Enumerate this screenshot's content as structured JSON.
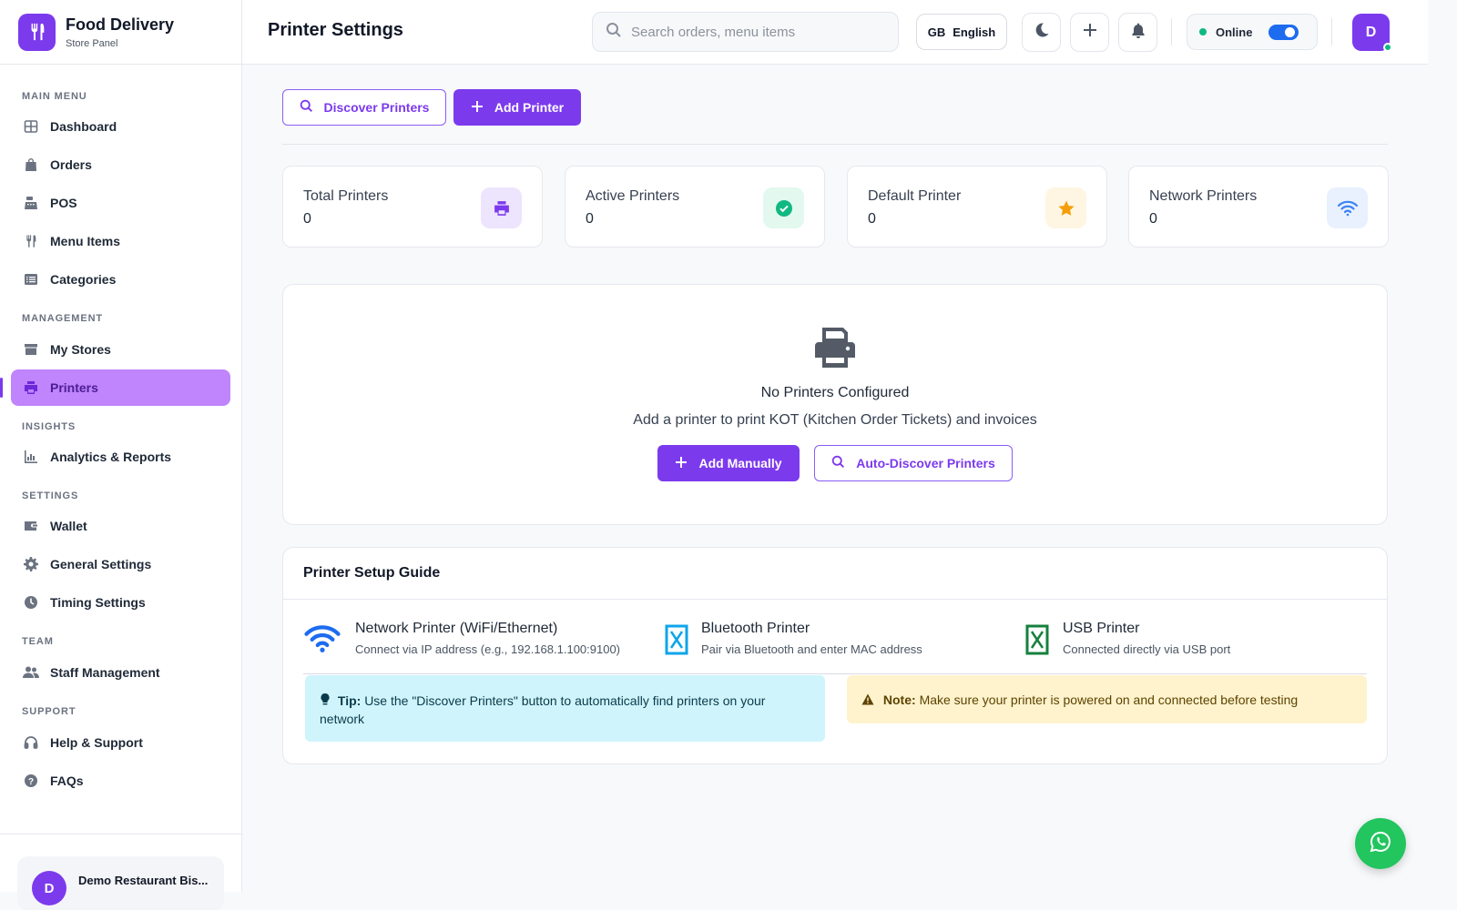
{
  "brand": {
    "title": "Food Delivery",
    "subtitle": "Store Panel",
    "icon": "utensils-icon"
  },
  "sidebar": {
    "sections": [
      {
        "title": "MAIN MENU",
        "items": [
          {
            "label": "Dashboard",
            "icon": "grid-icon"
          },
          {
            "label": "Orders",
            "icon": "shopping-bag-icon"
          },
          {
            "label": "POS",
            "icon": "cash-register-icon"
          },
          {
            "label": "Menu Items",
            "icon": "utensils-icon"
          },
          {
            "label": "Categories",
            "icon": "list-icon"
          }
        ]
      },
      {
        "title": "MANAGEMENT",
        "items": [
          {
            "label": "My Stores",
            "icon": "store-icon"
          },
          {
            "label": "Printers",
            "icon": "printer-icon",
            "active": true
          }
        ]
      },
      {
        "title": "INSIGHTS",
        "items": [
          {
            "label": "Analytics & Reports",
            "icon": "chart-icon"
          }
        ]
      },
      {
        "title": "SETTINGS",
        "items": [
          {
            "label": "Wallet",
            "icon": "wallet-icon"
          },
          {
            "label": "General Settings",
            "icon": "gear-icon"
          },
          {
            "label": "Timing Settings",
            "icon": "clock-icon"
          }
        ]
      },
      {
        "title": "TEAM",
        "items": [
          {
            "label": "Staff Management",
            "icon": "users-icon"
          }
        ]
      },
      {
        "title": "SUPPORT",
        "items": [
          {
            "label": "Help & Support",
            "icon": "headset-icon"
          },
          {
            "label": "FAQs",
            "icon": "question-icon"
          }
        ]
      }
    ],
    "store": {
      "avatar": "D",
      "name": "Demo Restaurant Bis..."
    }
  },
  "header": {
    "title": "Printer Settings",
    "search_placeholder": "Search orders, menu items",
    "lang_code": "GB",
    "lang_label": "English",
    "status_label": "Online",
    "online": true,
    "avatar": "D"
  },
  "actions": {
    "discover_label": "Discover Printers",
    "add_label": "Add Printer"
  },
  "stats": [
    {
      "label": "Total Printers",
      "value": "0",
      "icon": "printer-icon",
      "color": "#7c3aed",
      "bg": "#ede4fd"
    },
    {
      "label": "Active Printers",
      "value": "0",
      "icon": "check-circle-icon",
      "color": "#10b981",
      "bg": "#e3f8ef"
    },
    {
      "label": "Default Printer",
      "value": "0",
      "icon": "star-icon",
      "color": "#f59e0b",
      "bg": "#fef6e2"
    },
    {
      "label": "Network Printers",
      "value": "0",
      "icon": "wifi-icon",
      "color": "#3b82f6",
      "bg": "#e8f1fd"
    }
  ],
  "empty_state": {
    "title": "No Printers Configured",
    "subtitle": "Add a printer to print KOT (Kitchen Order Tickets) and invoices",
    "add_manually": "Add Manually",
    "auto_discover": "Auto-Discover Printers"
  },
  "guide": {
    "title": "Printer Setup Guide",
    "items": [
      {
        "title": "Network Printer (WiFi/Ethernet)",
        "desc": "Connect via IP address (e.g., 192.168.1.100:9100)",
        "icon": "wifi-icon",
        "color": "#1d6cf0"
      },
      {
        "title": "Bluetooth Printer",
        "desc": "Pair via Bluetooth and enter MAC address",
        "icon": "bluetooth-icon",
        "color": "#0ea5e9"
      },
      {
        "title": "USB Printer",
        "desc": "Connected directly via USB port",
        "icon": "usb-icon",
        "color": "#15803d"
      }
    ],
    "tip_label": "Tip:",
    "tip_text": "Use the \"Discover Printers\" button to automatically find printers on your network",
    "note_label": "Note:",
    "note_text": "Make sure your printer is powered on and connected before testing"
  },
  "fab": {
    "icon": "whatsapp-icon"
  },
  "colors": {
    "accent": "#7c3aed",
    "active_nav": "#c084fc",
    "online": "#10b981",
    "toggle": "#1d6cf0",
    "fab": "#22c55e"
  }
}
